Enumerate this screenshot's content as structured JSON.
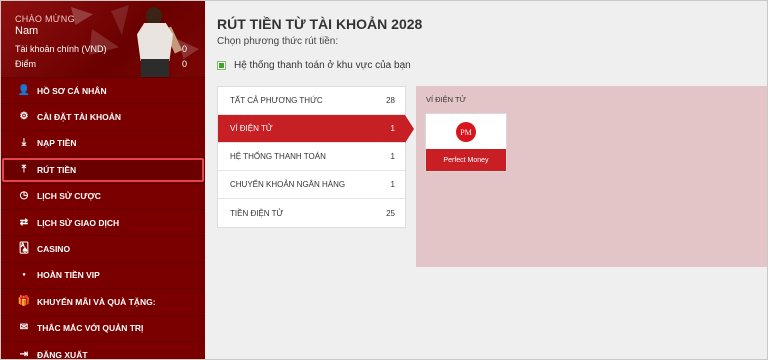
{
  "sidebar": {
    "welcome": "CHÀO MỪNG",
    "user_name": "Nam",
    "stats": [
      {
        "label": "Tài khoản chính (VND)",
        "value": "0"
      },
      {
        "label": "Điểm",
        "value": "0"
      }
    ],
    "menu": [
      {
        "label": "HỒ SƠ CÁ NHÂN",
        "icon": "user-plus-icon",
        "glyph": "👤"
      },
      {
        "label": "CÀI ĐẶT TÀI KHOẢN",
        "icon": "gears-icon",
        "glyph": "⚙"
      },
      {
        "label": "NẠP TIỀN",
        "icon": "download-icon",
        "glyph": "⤓"
      },
      {
        "label": "RÚT TIỀN",
        "icon": "upload-icon",
        "glyph": "⤒"
      },
      {
        "label": "LỊCH SỬ CƯỢC",
        "icon": "clock-icon",
        "glyph": "◷"
      },
      {
        "label": "LỊCH SỬ GIAO DỊCH",
        "icon": "exchange-icon",
        "glyph": "⇄"
      },
      {
        "label": "CASINO",
        "icon": "cards-icon",
        "glyph": "🂡"
      },
      {
        "label": "HOÀN TIỀN VIP",
        "icon": "bullet-icon",
        "glyph": "●"
      },
      {
        "label": "KHUYẾN MÃI VÀ QUÀ TẶNG:",
        "icon": "gift-hand-icon",
        "glyph": "🎁"
      },
      {
        "label": "THẮC MẮC VỚI QUẢN TRỊ",
        "icon": "envelope-icon",
        "glyph": "✉"
      },
      {
        "label": "ĐĂNG XUẤT",
        "icon": "sign-out-icon",
        "glyph": "⇥"
      }
    ],
    "active_label": "RÚT TIỀN"
  },
  "main": {
    "title": "RÚT TIỀN TỪ TÀI KHOẢN 2028",
    "subtitle": "Chọn phương thức rút tiền:",
    "region_checkbox_label": "Hệ thống thanh toán ở khu vực của bạn",
    "methods": [
      {
        "label": "TẤT CẢ PHƯƠNG THỨC",
        "count": "28"
      },
      {
        "label": "VÍ ĐIỆN TỬ",
        "count": "1"
      },
      {
        "label": "HỆ THỐNG THANH TOÁN",
        "count": "1"
      },
      {
        "label": "CHUYỂN KHOẢN NGÂN HÀNG",
        "count": "1"
      },
      {
        "label": "TIỀN ĐIỆN TỬ",
        "count": "25"
      }
    ],
    "active_method": "VÍ ĐIỆN TỬ",
    "panel_title": "VÍ ĐIỆN TỬ",
    "payment_option": {
      "logo_text": "PM",
      "label": "Perfect Money"
    }
  },
  "colors": {
    "sidebar_bg": "#7a0000",
    "accent_red": "#c61f24",
    "panel_bg": "#e3c5c7",
    "active_outline": "#e8434a",
    "check_green": "#3fa52e"
  }
}
